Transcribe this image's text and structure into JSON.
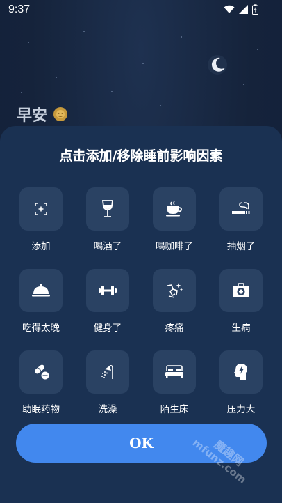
{
  "status_bar": {
    "time": "9:37",
    "icons": [
      "wifi-icon",
      "signal-icon",
      "battery-charging-icon"
    ]
  },
  "background": {
    "greeting": "早安"
  },
  "sheet": {
    "title": "点击添加/移除睡前影响因素",
    "items": [
      {
        "label": "添加",
        "icon": "add-scan-icon"
      },
      {
        "label": "喝酒了",
        "icon": "wine-glass-icon"
      },
      {
        "label": "喝咖啡了",
        "icon": "coffee-cup-icon"
      },
      {
        "label": "抽烟了",
        "icon": "cigarette-icon"
      },
      {
        "label": "吃得太晚",
        "icon": "food-cloche-icon"
      },
      {
        "label": "健身了",
        "icon": "dumbbell-icon"
      },
      {
        "label": "疼痛",
        "icon": "pain-icon"
      },
      {
        "label": "生病",
        "icon": "first-aid-kit-icon"
      },
      {
        "label": "助眠药物",
        "icon": "pill-icon"
      },
      {
        "label": "洗澡",
        "icon": "shower-icon"
      },
      {
        "label": "陌生床",
        "icon": "bed-icon"
      },
      {
        "label": "压力大",
        "icon": "stress-head-icon"
      }
    ],
    "ok_label": "OK"
  },
  "watermark": {
    "site_cn": "魔趣网",
    "site_en": "mfunz.com"
  },
  "colors": {
    "sheet_bg": "#1a3152",
    "tile_bg": "#2a4263",
    "button": "#4288ee"
  }
}
